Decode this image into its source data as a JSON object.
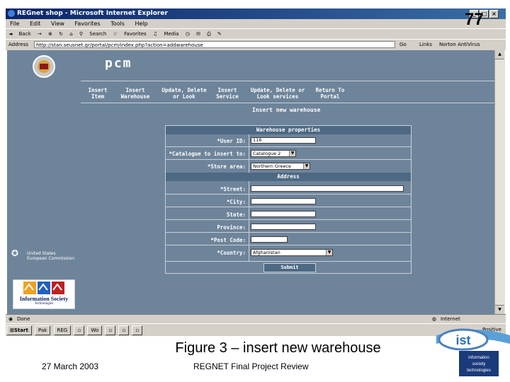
{
  "window": {
    "title": "REGnet shop - Microsoft Internet Explorer",
    "min": "_",
    "max": "□",
    "close": "×"
  },
  "menubar": [
    "File",
    "Edit",
    "View",
    "Favorites",
    "Tools",
    "Help"
  ],
  "toolbar": {
    "back": "Back",
    "forward": "→",
    "search": "Search",
    "favorites": "Favorites",
    "media": "Media"
  },
  "addressbar": {
    "label": "Address",
    "url": "http://stan.seusnet.gr/portal/pcm/index.php?action=addwarehouse",
    "go": "Go",
    "links": "Links",
    "norton": "Norton AntiVirus"
  },
  "page": {
    "brand": "pcm",
    "nav": [
      {
        "label": "Insert\nItem"
      },
      {
        "label": "Insert\nWarehouse"
      },
      {
        "label": "Update, Delete\nor Look"
      },
      {
        "label": "Insert\nService"
      },
      {
        "label": "Update, Delete or\nLook services"
      },
      {
        "label": "Return To\nPortal"
      }
    ],
    "subheading": "Insert new warehouse",
    "form": {
      "section1": "Warehouse properties",
      "user_id_label": "*User ID:",
      "user_id_value": "116",
      "catalogue_label": "*Catalogue to insert to:",
      "catalogue_value": "Catalogue 2",
      "store_area_label": "*Store area:",
      "store_area_value": "Northern Greece",
      "section2": "Address",
      "street_label": "*Street:",
      "city_label": "*City:",
      "state_label": "State:",
      "province_label": "Province:",
      "postcode_label": "*Post Code:",
      "country_label": "*Country:",
      "country_value": "Afghanistan",
      "submit": "Submit"
    },
    "eu_text": "United States\nEuropean Commission",
    "ist_logo_text": "Information Society",
    "ist_logo_sub": "Technologies"
  },
  "statusbar": {
    "left": "Done",
    "right": "Internet"
  },
  "taskbar": {
    "start": "Start",
    "time": "Positive",
    "tasks": [
      "Pak",
      "REG",
      "",
      "Wo",
      "",
      "",
      "",
      ""
    ]
  },
  "slide": {
    "number": "77",
    "caption": "Figure 3 – insert new warehouse",
    "date": "27 March 2003",
    "footer_title": "REGNET Final Project Review",
    "ist_logo_text": "ist",
    "ist_logo_sub": "information\nsociety\ntechnologies"
  }
}
